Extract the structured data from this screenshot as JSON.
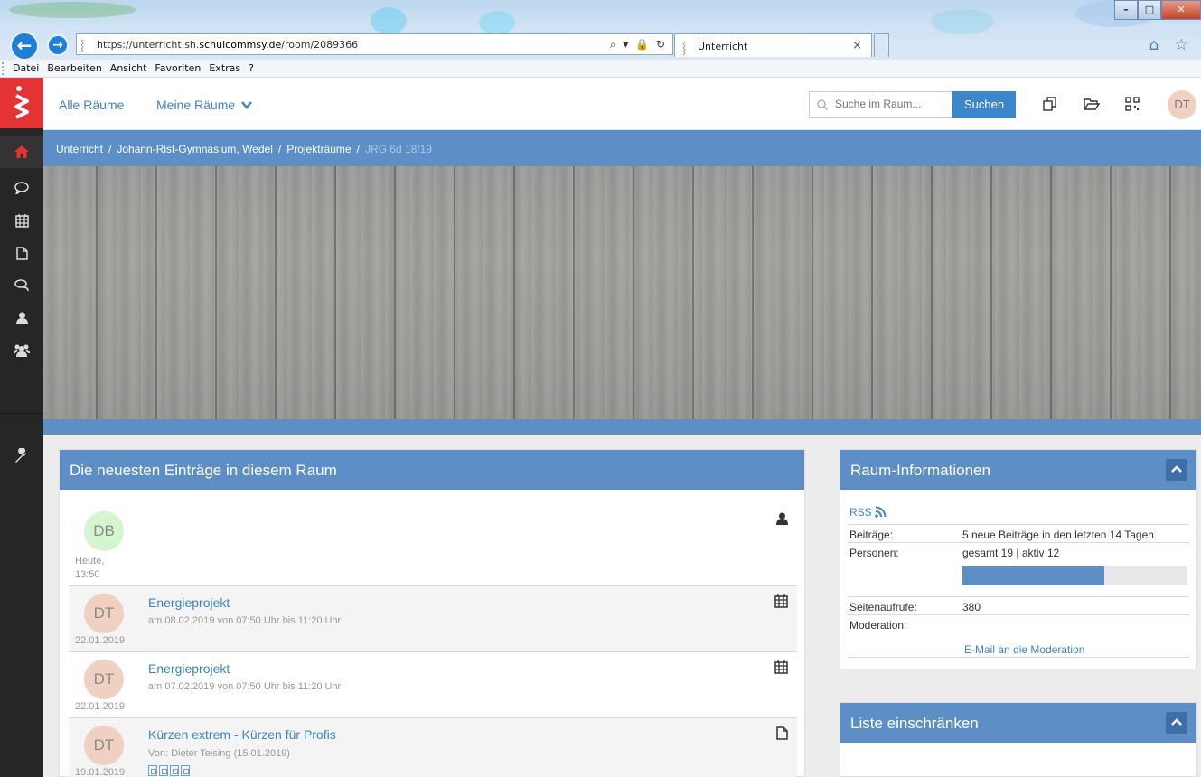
{
  "browser": {
    "url_prefix": "https://unterricht.sh.",
    "url_domain": "schulcommsy.de",
    "url_path": "/room/2089366",
    "address_controls": "⌕ ▾ 🔒 ↻",
    "tab_title": "Unterricht",
    "tab_close": "×",
    "toolbar_icons": "⌂ ☆",
    "window_buttons": [
      "–",
      "□",
      "✕"
    ],
    "menu": [
      "Datei",
      "Bearbeiten",
      "Ansicht",
      "Favoriten",
      "Extras",
      "?"
    ]
  },
  "sidebar": {
    "items": [
      {
        "icon": "home-icon",
        "active": true
      },
      {
        "icon": "chat-bubble-icon"
      },
      {
        "icon": "calendar-icon"
      },
      {
        "icon": "document-icon"
      },
      {
        "icon": "discussion-icon"
      },
      {
        "icon": "person-icon"
      },
      {
        "icon": "group-icon"
      },
      {
        "icon": "wrench-icon"
      }
    ],
    "accent": "#e53333",
    "background": "#262626"
  },
  "header": {
    "all_rooms": "Alle Räume",
    "my_rooms": "Meine Räume",
    "search_placeholder": "Suche im Raum...",
    "search_button": "Suchen",
    "user_initials": "DT"
  },
  "breadcrumb": {
    "items": [
      "Unterricht",
      "Johann-Rist-Gymnasium, Wedel",
      "Projekträume"
    ],
    "separator": "/",
    "current": "JRG 6d 18/19"
  },
  "entries": {
    "title": "Die neuesten Einträge in diesem Raum",
    "items": [
      {
        "initials": "DB",
        "date_line1": "Heute,",
        "date_line2": "13:50",
        "title": "",
        "meta": "",
        "type_icon": "person-icon",
        "avatar_color": "#d5f5cf"
      },
      {
        "initials": "DT",
        "date_line1": "22.01.2019",
        "title": "Energieprojekt",
        "meta": "am 08.02.2019 von 07:50 Uhr bis 11:20 Uhr",
        "type_icon": "calendar-icon",
        "avatar_color": "#f0d1c1"
      },
      {
        "initials": "DT",
        "date_line1": "22.01.2019",
        "title": "Energieprojekt",
        "meta": "am 07.02.2019 von 07:50 Uhr bis 11:20 Uhr",
        "type_icon": "calendar-icon",
        "avatar_color": "#f0d1c1"
      },
      {
        "initials": "DT",
        "date_line1": "19.01.2019",
        "title": "Kürzen extrem - Kürzen für Profis",
        "meta": "Von: Dieter Teising (15.01.2019)",
        "type_icon": "document-icon",
        "avatar_color": "#f0d1c1",
        "attachments": 4
      }
    ]
  },
  "room_info": {
    "title": "Raum-Informationen",
    "rss": "RSS",
    "rows": [
      {
        "key": "Beiträge:",
        "value": "5 neue Beiträge in den letzten 14 Tagen"
      },
      {
        "key": "Personen:",
        "value": "gesamt 19 | aktiv 12"
      },
      {
        "key": "Seitenaufrufe:",
        "value": "380"
      },
      {
        "key": "Moderation:",
        "value": ""
      }
    ],
    "active_fraction": 0.63,
    "moderation_link": "E-Mail an die Moderation"
  },
  "filter_panel": {
    "title": "Liste einschränken"
  },
  "colors": {
    "primary": "#5d8fc6",
    "link": "#3f84c6",
    "button": "#3d86ce"
  }
}
